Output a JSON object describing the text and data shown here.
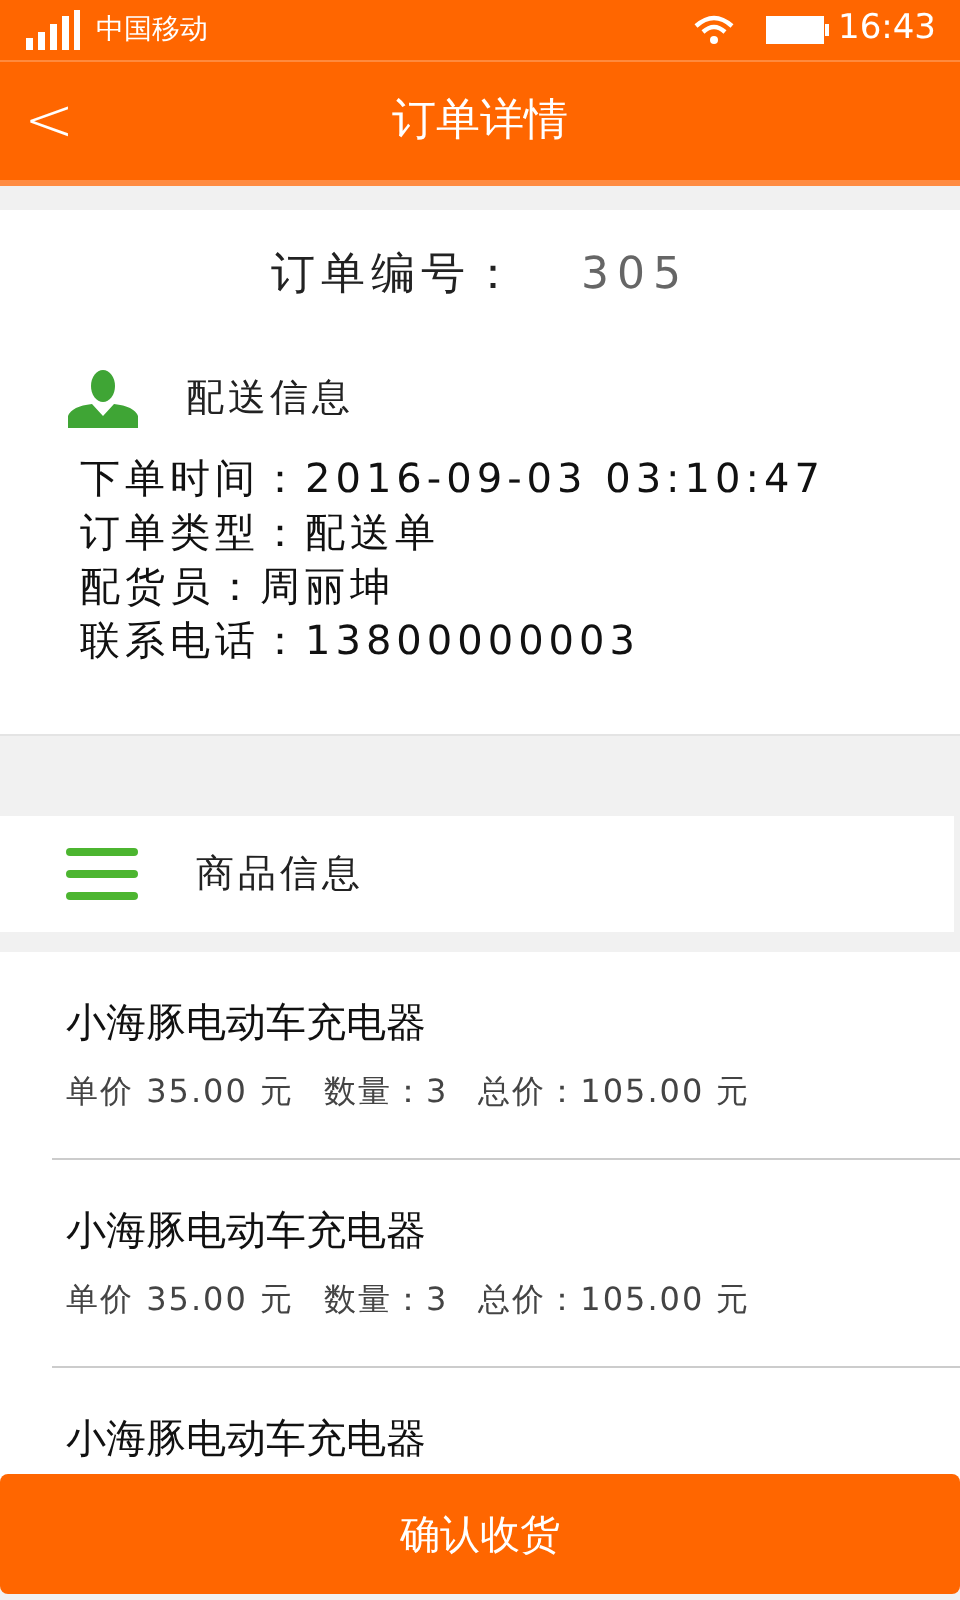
{
  "status_bar": {
    "carrier": "中国移动",
    "time": "16:43"
  },
  "header": {
    "back": "<",
    "title": "订单详情"
  },
  "order": {
    "label": "订单编号：",
    "number": "305"
  },
  "delivery": {
    "title": "配送信息",
    "lines": [
      "下单时间：2016-09-03 03:10:47",
      "订单类型：配送单",
      "配货员：周丽坤",
      "联系电话：13800000003"
    ]
  },
  "goods": {
    "title": "商品信息",
    "items": [
      {
        "name": "小海豚电动车充电器",
        "price": "单价 35.00 元",
        "quantity": "数量：3",
        "total": "总价：105.00 元"
      },
      {
        "name": "小海豚电动车充电器",
        "price": "单价 35.00 元",
        "quantity": "数量：3",
        "total": "总价：105.00 元"
      },
      {
        "name": "小海豚电动车充电器"
      }
    ]
  },
  "confirm_button": "确认收货"
}
